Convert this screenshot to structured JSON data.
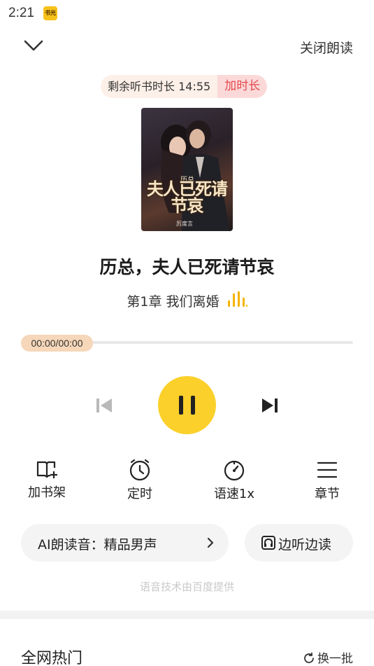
{
  "status_bar": {
    "time": "2:21",
    "app_icon_label": "书光"
  },
  "header": {
    "close_label": "关闭朗读"
  },
  "timer": {
    "remaining_label": "剩余听书时长 14:55",
    "add_label": "加时长"
  },
  "book": {
    "cover_title": "夫人已死请节哀",
    "cover_small": "历总",
    "cover_author": "厉度言",
    "title": "历总，夫人已死请节哀",
    "chapter": "第1章 我们离婚"
  },
  "player": {
    "time_label": "00:00/00:00",
    "progress": 0,
    "state": "playing"
  },
  "tools": [
    {
      "label": "加书架",
      "icon": "add-bookshelf-icon"
    },
    {
      "label": "定时",
      "icon": "clock-icon"
    },
    {
      "label": "语速1x",
      "icon": "speed-gauge-icon"
    },
    {
      "label": "章节",
      "icon": "list-icon"
    }
  ],
  "voice": {
    "label": "AI朗读音：精品男声",
    "listen_read_label": "边听边读"
  },
  "credit": "语音技术由百度提供",
  "section": {
    "title": "全网热门",
    "refresh_label": "换一批"
  },
  "colors": {
    "accent": "#fbd02a",
    "progress_thumb": "#f6d7b9",
    "add_time_text": "#e5484d"
  }
}
